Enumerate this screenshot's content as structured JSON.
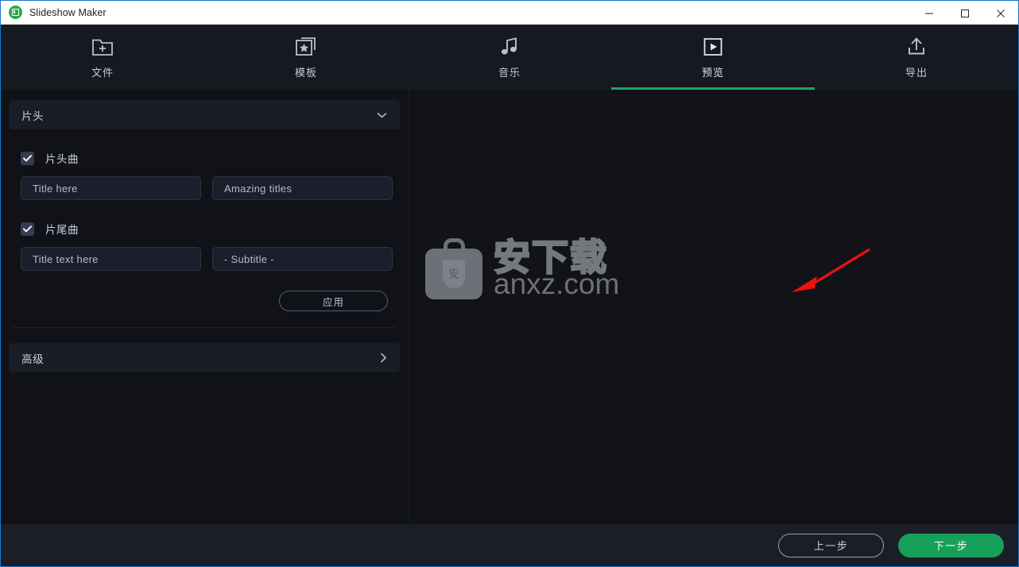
{
  "window": {
    "title": "Slideshow Maker",
    "logo_icon": "slideshow-maker-logo",
    "minimize_label": "—",
    "maximize_label": "□",
    "close_label": "✕",
    "accent_green": "#23a261",
    "border_blue": "#1976c8"
  },
  "toolbar": {
    "tabs": [
      {
        "label": "文件",
        "icon": "folder-plus-icon",
        "active": false
      },
      {
        "label": "模板",
        "icon": "template-star-icon",
        "active": false
      },
      {
        "label": "音乐",
        "icon": "music-note-icon",
        "active": false
      },
      {
        "label": "预览",
        "icon": "preview-play-icon",
        "active": true
      },
      {
        "label": "导出",
        "icon": "export-upload-icon",
        "active": false
      }
    ]
  },
  "left_panel": {
    "opening_section": {
      "title": "片头",
      "chevron_icon": "chevron-down-icon",
      "opening_theme": {
        "checkbox_label": "片头曲",
        "checked": true,
        "title_value": "Title here",
        "subtitle_value": "Amazing titles"
      },
      "ending_theme": {
        "checkbox_label": "片尾曲",
        "checked": true,
        "title_value": "Title text here",
        "subtitle_value": "- Subtitle -"
      },
      "apply_label": "应用"
    },
    "advanced_section": {
      "title": "高级",
      "chevron_icon": "chevron-right-icon"
    }
  },
  "preview": {
    "watermark": {
      "chinese_text": "安下载",
      "domain_text": "anxz.com",
      "shield_char": "安",
      "logo_icon": "anxz-bag-logo"
    },
    "play_button_icon": "play-triangle-icon",
    "annotation_icon": "red-arrow-annotation"
  },
  "footer": {
    "prev_label": "上一步",
    "next_label": "下一步",
    "next_color": "#16a05a"
  }
}
